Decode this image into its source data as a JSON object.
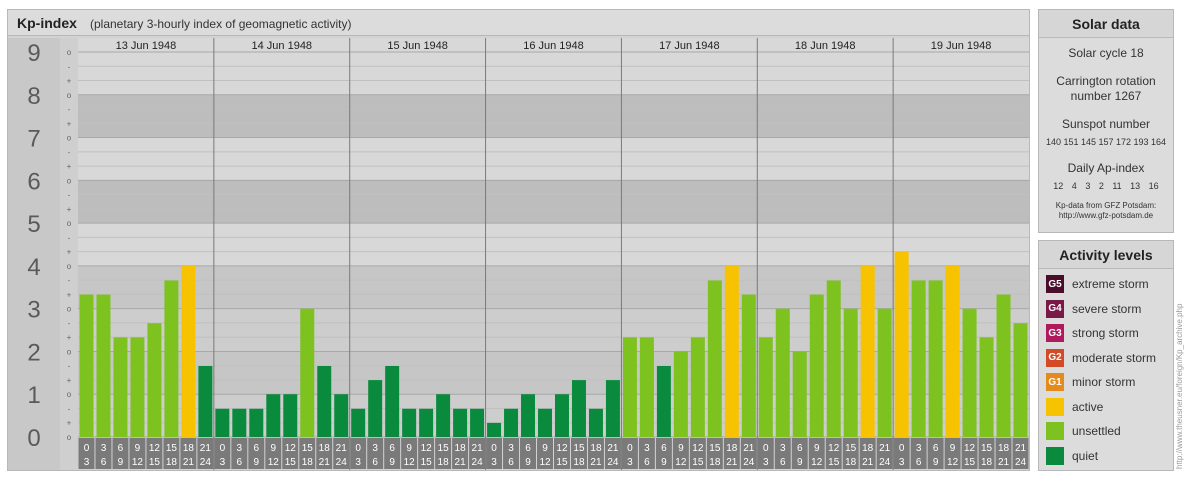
{
  "header": {
    "title": "Kp-index",
    "subtitle": "(planetary 3-hourly index of geomagnetic activity)"
  },
  "solar": {
    "title": "Solar data",
    "cycle": "Solar cycle 18",
    "carrington_line1": "Carrington rotation",
    "carrington_line2": "number 1267",
    "sunspot_title": "Sunspot number",
    "sunspot_values": "140 151 145 157 172 193 164",
    "ap_title": "Daily Ap-index",
    "ap_values": "12 4 3 2 11 13 16",
    "source_line1": "Kp-data from GFZ Potsdam:",
    "source_line2": "http://www.gfz-potsdam.de"
  },
  "activity": {
    "title": "Activity levels",
    "items": [
      {
        "code": "G5",
        "label": "extreme storm",
        "color": "#4a0e2a"
      },
      {
        "code": "G4",
        "label": "severe storm",
        "color": "#7a1848"
      },
      {
        "code": "G3",
        "label": "strong storm",
        "color": "#b01a5c"
      },
      {
        "code": "G2",
        "label": "moderate storm",
        "color": "#d24a26"
      },
      {
        "code": "G1",
        "label": "minor storm",
        "color": "#e58a1c"
      },
      {
        "code": "",
        "label": "active",
        "color": "#f7c300"
      },
      {
        "code": "",
        "label": "unsettled",
        "color": "#7dc21f"
      },
      {
        "code": "",
        "label": "quiet",
        "color": "#0a8a3c"
      }
    ]
  },
  "watermark": "http://www.theusner.eu/foreign/Kp_archive.php",
  "chart_data": {
    "type": "bar",
    "ylim": [
      0,
      9
    ],
    "y_ticks": [
      "0",
      "1",
      "2",
      "3",
      "4",
      "5",
      "6",
      "7",
      "8",
      "9"
    ],
    "minor_labels": [
      "o",
      "+",
      "-",
      "o"
    ],
    "days": [
      "13 Jun 1948",
      "14 Jun 1948",
      "15 Jun 1948",
      "16 Jun 1948",
      "17 Jun 1948",
      "18 Jun 1948",
      "19 Jun 1948"
    ],
    "intervals": [
      [
        "0",
        "3"
      ],
      [
        "3",
        "6"
      ],
      [
        "6",
        "9"
      ],
      [
        "9",
        "12"
      ],
      [
        "12",
        "15"
      ],
      [
        "15",
        "18"
      ],
      [
        "18",
        "21"
      ],
      [
        "21",
        "24"
      ]
    ],
    "values": [
      [
        3.0,
        3.0,
        2.0,
        2.0,
        2.33,
        3.33,
        3.67,
        1.33
      ],
      [
        0.33,
        0.33,
        0.33,
        0.67,
        0.67,
        2.67,
        1.33,
        0.67
      ],
      [
        0.33,
        1.0,
        1.33,
        0.33,
        0.33,
        0.67,
        0.33,
        0.33
      ],
      [
        0.0,
        0.33,
        0.67,
        0.33,
        0.67,
        1.0,
        0.33,
        1.0
      ],
      [
        2.0,
        2.0,
        1.33,
        1.67,
        2.0,
        3.33,
        3.67,
        3.0
      ],
      [
        2.0,
        2.67,
        1.67,
        3.0,
        3.33,
        2.67,
        3.67,
        2.67
      ],
      [
        4.0,
        3.33,
        3.33,
        3.67,
        2.67,
        2.0,
        3.0,
        2.33
      ]
    ],
    "level_colors": {
      "quiet": "#0a8a3c",
      "unsettled": "#7dc21f",
      "active": "#f7c300"
    }
  }
}
